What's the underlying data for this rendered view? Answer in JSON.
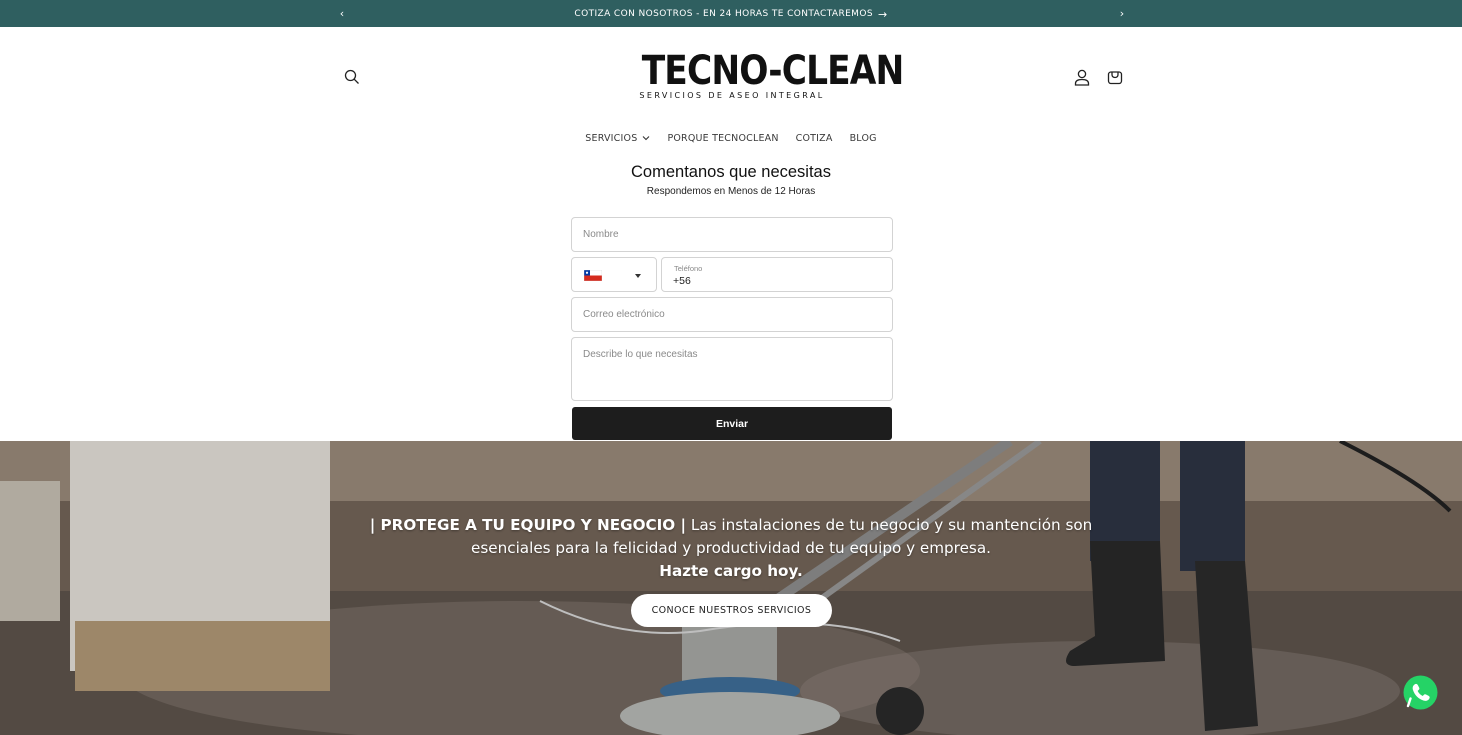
{
  "announcement": {
    "text": "COTIZA CON NOSOTROS - EN 24 HORAS TE CONTACTAREMOS",
    "arrow": "→",
    "prev_icon": "chevron-left-icon",
    "next_icon": "chevron-right-icon",
    "background": "#2f5f60"
  },
  "header": {
    "logo_wordmark": "TECNO-CLEAN",
    "logo_tagline": "SERVICIOS DE ASEO INTEGRAL",
    "icons": [
      "search-icon",
      "account-icon",
      "cart-icon"
    ]
  },
  "nav": {
    "items": [
      {
        "label": "SERVICIOS",
        "has_dropdown": true
      },
      {
        "label": "PORQUE TECNOCLEAN"
      },
      {
        "label": "COTIZA"
      },
      {
        "label": "BLOG"
      }
    ]
  },
  "form": {
    "title": "Comentanos que necesitas",
    "subtitle": "Respondemos en Menos de 12 Horas",
    "name_placeholder": "Nombre",
    "phone_label": "Teléfono",
    "phone_value": "+56",
    "country_icon": "chile-flag-icon",
    "email_placeholder": "Correo electrónico",
    "message_placeholder": "Describe lo que necesitas",
    "submit_label": "Enviar"
  },
  "hero": {
    "heading": "| PROTEGE A TU EQUIPO Y NEGOCIO |",
    "body": " Las instalaciones de tu negocio y su mantención son esenciales para la felicidad y productividad de tu equipo y empresa.",
    "cta_text": "Hazte cargo hoy.",
    "button_label": "CONOCE NUESTROS SERVICIOS"
  },
  "floating": {
    "whatsapp_icon": "whatsapp-icon",
    "whatsapp_color": "#25d366"
  }
}
